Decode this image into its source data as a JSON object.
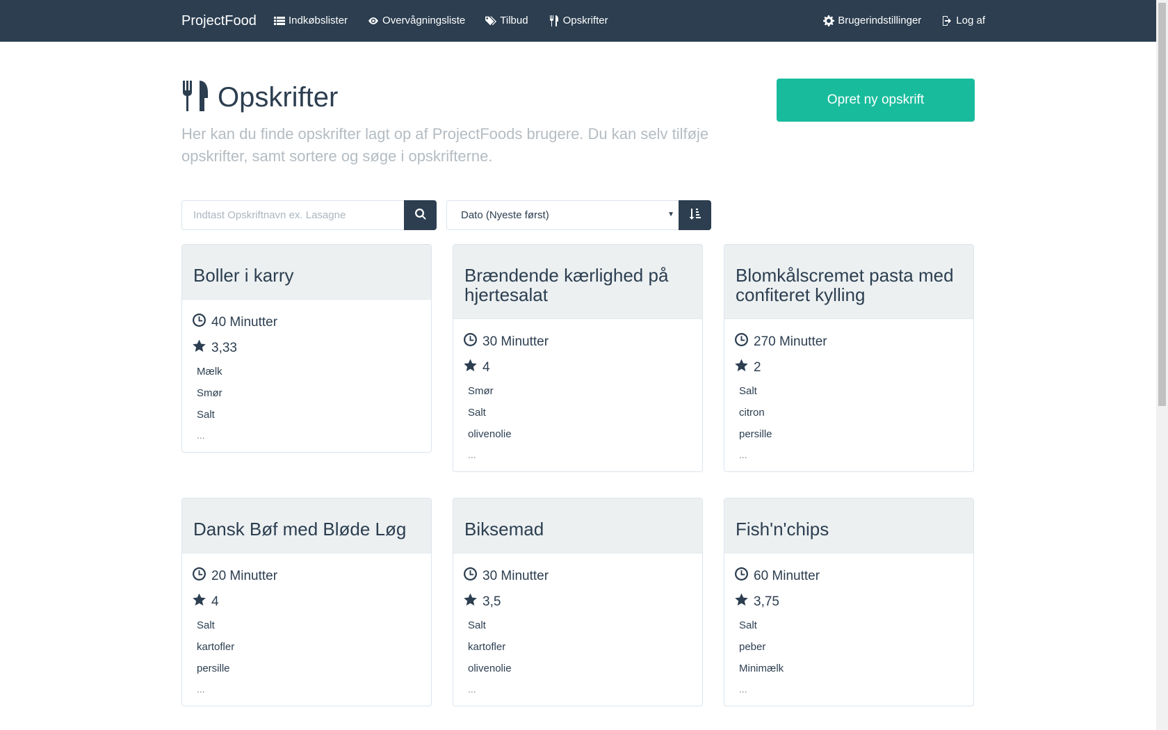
{
  "navbar": {
    "brand": "ProjectFood",
    "left_items": [
      {
        "label": "Indkøbslister",
        "icon": "list-icon"
      },
      {
        "label": "Overvågningsliste",
        "icon": "eye-icon"
      },
      {
        "label": "Tilbud",
        "icon": "tags-icon"
      },
      {
        "label": "Opskrifter",
        "icon": "cutlery-icon"
      }
    ],
    "right_items": [
      {
        "label": "Brugerindstillinger",
        "icon": "gear-icon"
      },
      {
        "label": "Log af",
        "icon": "logout-icon"
      }
    ]
  },
  "header": {
    "title": "Opskrifter",
    "lead": "Her kan du finde opskrifter lagt op af ProjectFoods brugere. Du kan selv tilføje opskrifter, samt sortere og søge i opskrifterne.",
    "create_button": "Opret ny opskrift"
  },
  "search": {
    "placeholder": "Indtast Opskriftnavn ex. Lasagne",
    "value": ""
  },
  "sort": {
    "selected": "Dato (Nyeste først)"
  },
  "recipes": [
    {
      "title": "Boller i karry",
      "time": "40 Minutter",
      "rating": "3,33",
      "ingredients": [
        "Mælk",
        "Smør",
        "Salt"
      ],
      "more": "..."
    },
    {
      "title": "Brændende kærlighed på hjertesalat",
      "time": "30 Minutter",
      "rating": "4",
      "ingredients": [
        "Smør",
        "Salt",
        "olivenolie"
      ],
      "more": "..."
    },
    {
      "title": "Blomkålscremet pasta med confiteret kylling",
      "time": "270 Minutter",
      "rating": "2",
      "ingredients": [
        "Salt",
        "citron",
        "persille"
      ],
      "more": "..."
    },
    {
      "title": "Dansk Bøf med Bløde Løg",
      "time": "20 Minutter",
      "rating": "4",
      "ingredients": [
        "Salt",
        "kartofler",
        "persille"
      ],
      "more": "..."
    },
    {
      "title": "Biksemad",
      "time": "30 Minutter",
      "rating": "3,5",
      "ingredients": [
        "Salt",
        "kartofler",
        "olivenolie"
      ],
      "more": "..."
    },
    {
      "title": "Fish'n'chips",
      "time": "60 Minutter",
      "rating": "3,75",
      "ingredients": [
        "Salt",
        "peber",
        "Minimælk"
      ],
      "more": "..."
    }
  ],
  "colors": {
    "navbar": "#2c3e50",
    "accent": "#18bc9c",
    "card_header": "#ecf0f1",
    "lead_text": "#b4bcc2"
  }
}
